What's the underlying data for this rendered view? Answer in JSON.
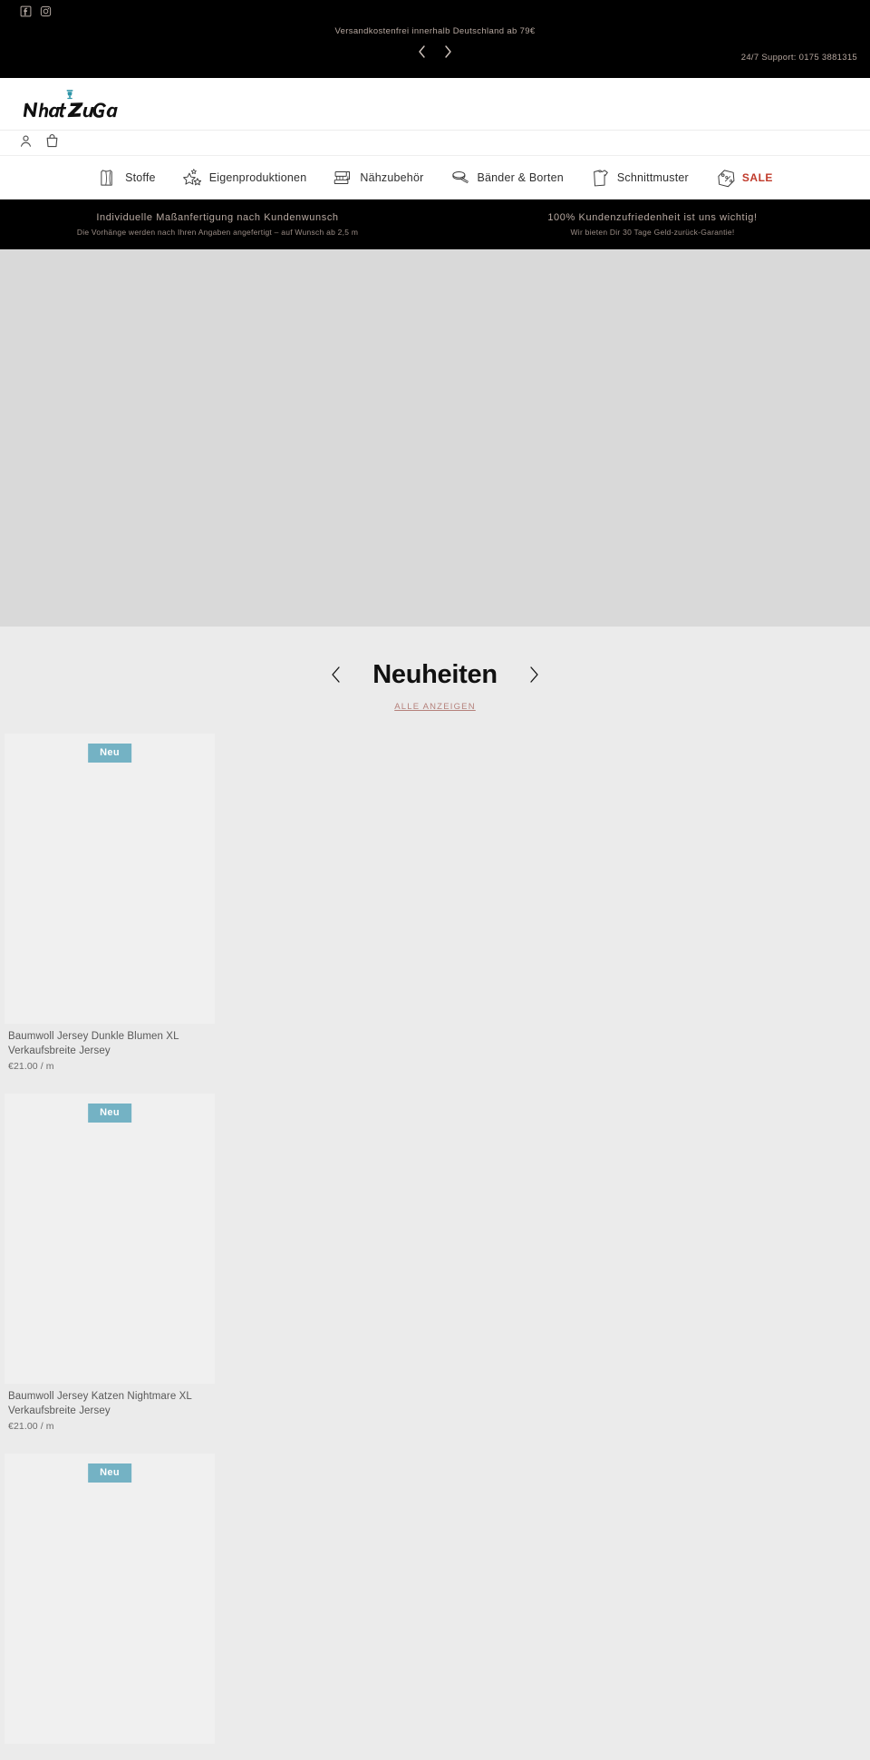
{
  "announcement": {
    "social": [
      {
        "name": "facebook-icon",
        "label": "Facebook"
      },
      {
        "name": "instagram-icon",
        "label": "Instagram"
      }
    ],
    "message": "Versandkostenfrei innerhalb Deutschland ab 79€",
    "prev_label": "‹",
    "next_label": "›",
    "support": "24/7 Support: 0175 3881315",
    "bg_color": "#000000",
    "text_color": "#b6a79f"
  },
  "header": {
    "logo_text": "NahtZuGabe",
    "logo_accent_color": "#2e95a8"
  },
  "utilities": {
    "items": [
      {
        "name": "account-icon",
        "label": "Konto"
      },
      {
        "name": "cart-icon",
        "label": "Warenkorb"
      }
    ]
  },
  "nav": {
    "items": [
      {
        "label": "Stoffe",
        "icon": "fabric-icon",
        "sale": false
      },
      {
        "label": "Eigenproduktionen",
        "icon": "stars-icon",
        "sale": false
      },
      {
        "label": "Nähzubehör",
        "icon": "sewing-machine-icon",
        "sale": false
      },
      {
        "label": "Bänder & Borten",
        "icon": "ribbon-icon",
        "sale": false
      },
      {
        "label": "Schnittmuster",
        "icon": "pattern-icon",
        "sale": false
      },
      {
        "label": "SALE",
        "icon": "price-tag-icon",
        "sale": true
      }
    ],
    "sale_color": "#c03a2b"
  },
  "usp": {
    "columns": [
      {
        "title": "Individuelle Maßanfertigung nach Kundenwunsch",
        "subtitle": "Die Vorhänge werden nach Ihren Angaben angefertigt – auf Wunsch ab 2,5 m"
      },
      {
        "title": "100% Kundenzufriedenheit ist uns wichtig!",
        "subtitle": "Wir bieten Dir 30 Tage Geld-zurück-Garantie!"
      }
    ]
  },
  "hero": {
    "name": "hero-banner",
    "bg_color": "#d9d9d9"
  },
  "collection": {
    "title": "Neuheiten",
    "prev_label": "‹",
    "next_label": "›",
    "view_all": "ALLE ANZEIGEN",
    "link_color": "#b5817b",
    "badge_color": "#74b2c4",
    "products": [
      {
        "badge": "Neu",
        "title": "Baumwoll Jersey Dunkle Blumen XL",
        "subtitle": "Verkaufsbreite Jersey",
        "price": "€21.00 / m"
      },
      {
        "badge": "Neu",
        "title": "Baumwoll Jersey Katzen Nightmare XL",
        "subtitle": "Verkaufsbreite Jersey",
        "price": "€21.00 / m"
      },
      {
        "badge": "Neu",
        "title": "",
        "subtitle": "",
        "price": ""
      }
    ]
  }
}
